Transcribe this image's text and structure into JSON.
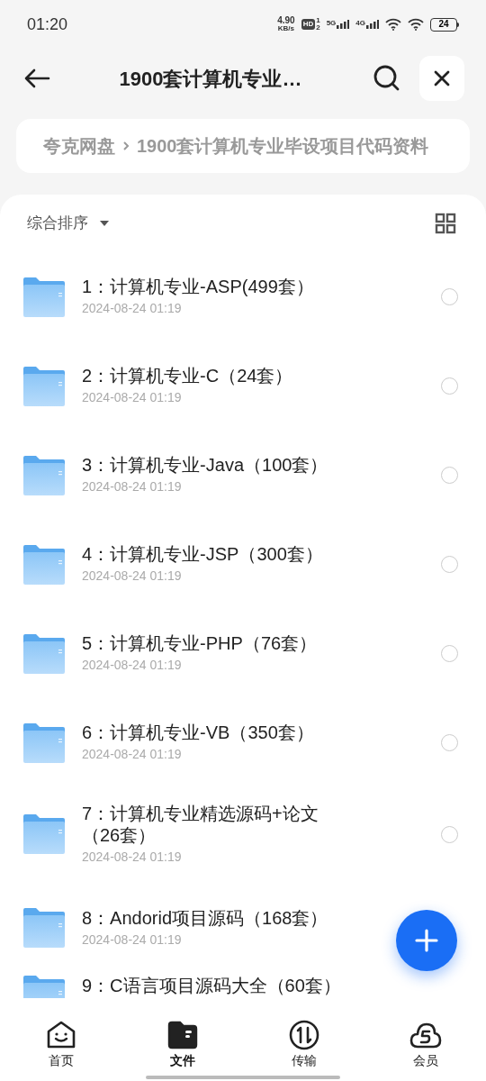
{
  "status_bar": {
    "time": "01:20",
    "speed_value": "4.90",
    "speed_unit": "KB/s",
    "hd": "HD",
    "hd_sims": [
      "1",
      "2"
    ],
    "networks": [
      "5G",
      "4G"
    ],
    "battery": "24"
  },
  "header": {
    "title": "1900套计算机专业…"
  },
  "breadcrumb": [
    {
      "label": "夸克网盘"
    },
    {
      "label": "1900套计算机专业毕设项目代码资料"
    }
  ],
  "sort": {
    "label": "综合排序"
  },
  "files": [
    {
      "name": "1：计算机专业-ASP(499套）",
      "date": "2024-08-24 01:19",
      "selected": false
    },
    {
      "name": "2：计算机专业-C（24套）",
      "date": "2024-08-24 01:19",
      "selected": false
    },
    {
      "name": "3：计算机专业-Java（100套）",
      "date": "2024-08-24 01:19",
      "selected": false
    },
    {
      "name": "4：计算机专业-JSP（300套）",
      "date": "2024-08-24 01:19",
      "selected": false
    },
    {
      "name": "5：计算机专业-PHP（76套）",
      "date": "2024-08-24 01:19",
      "selected": false
    },
    {
      "name": "6：计算机专业-VB（350套）",
      "date": "2024-08-24 01:19",
      "selected": false
    },
    {
      "name": "7：计算机专业精选源码+论文（26套）",
      "date": "2024-08-24 01:19",
      "selected": false
    },
    {
      "name": "8：Andorid项目源码（168套）",
      "date": "2024-08-24 01:19"
    },
    {
      "name": "9：C语言项目源码大全（60套）"
    }
  ],
  "nav": [
    {
      "kind": "home",
      "label": "首页",
      "selected": false
    },
    {
      "kind": "files",
      "label": "文件",
      "selected": true
    },
    {
      "kind": "transfer",
      "label": "传输",
      "selected": false
    },
    {
      "kind": "member",
      "label": "会员",
      "selected": false
    }
  ]
}
